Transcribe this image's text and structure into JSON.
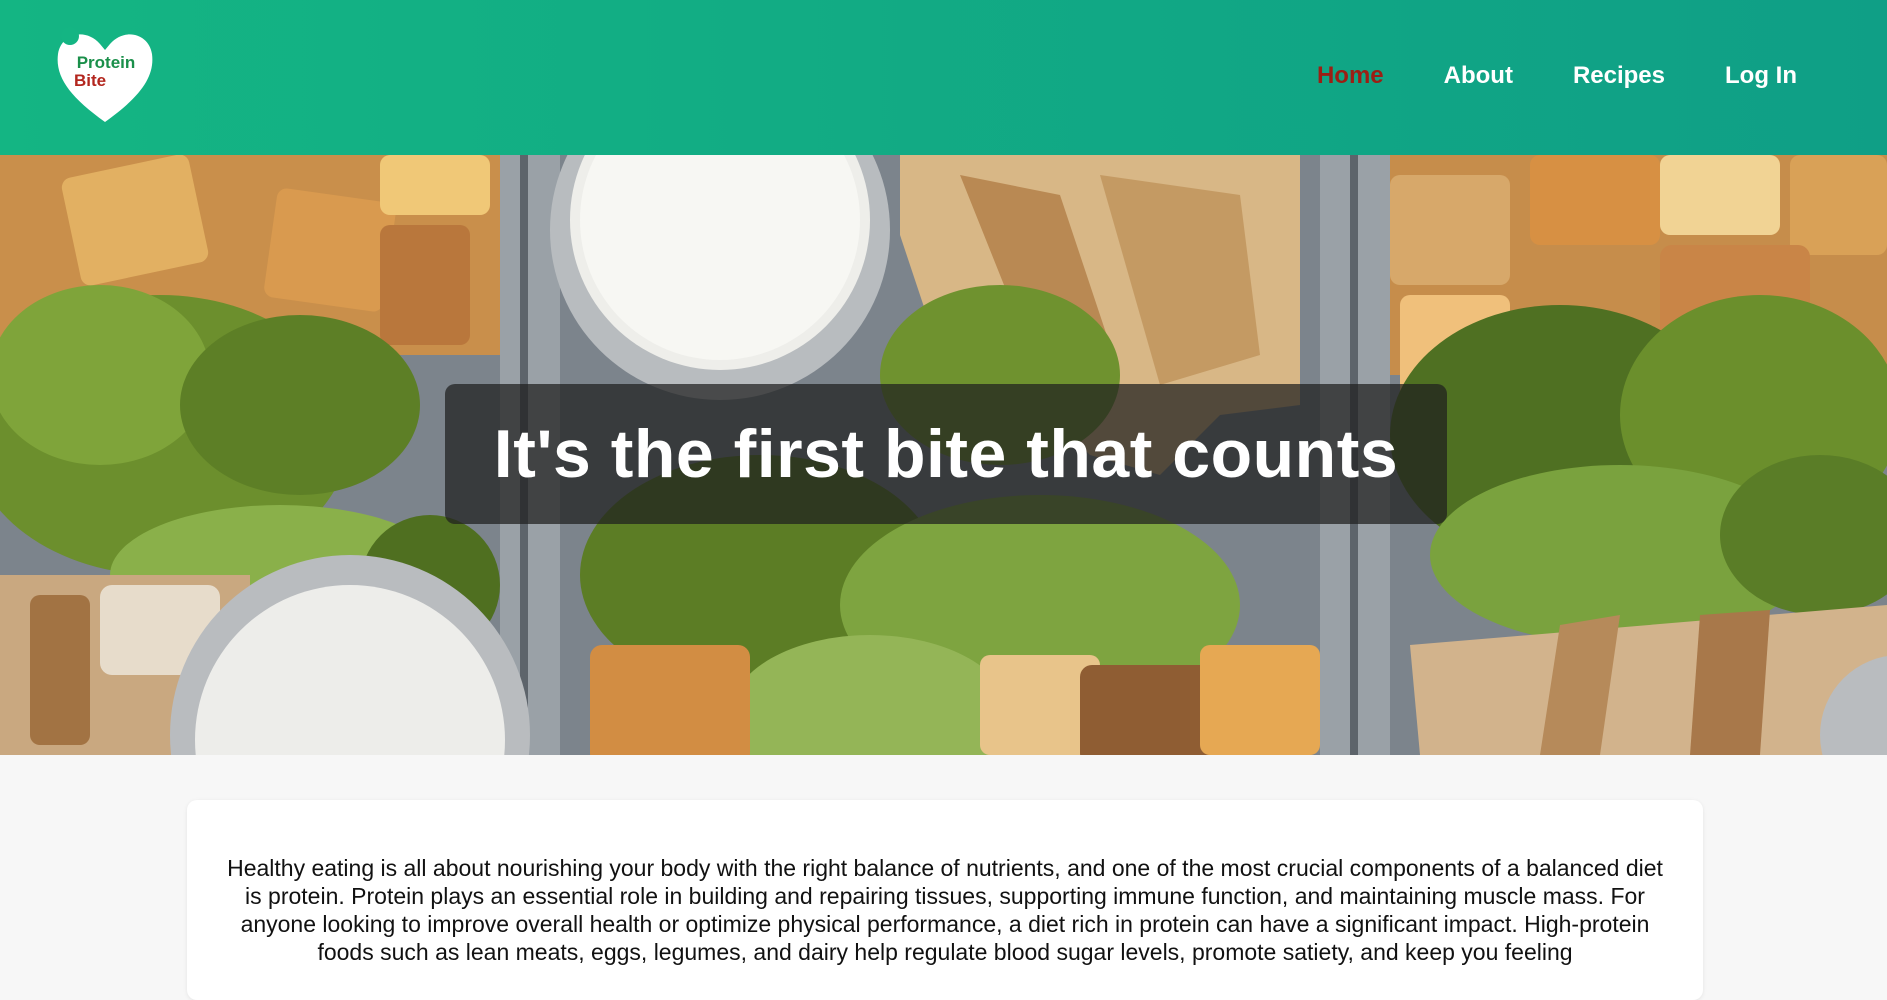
{
  "brand": {
    "logo_line1": "Protein",
    "logo_line2": "Bite",
    "logo_heart_color": "#ffffff",
    "logo_text_green": "#1a8f4a",
    "logo_text_red": "#b3261e"
  },
  "colors": {
    "header_start": "#14b583",
    "header_end": "#0f9f86",
    "nav_active": "#9c1f14",
    "nav_default": "#ffffff"
  },
  "nav": {
    "items": [
      {
        "label": "Home",
        "active": true
      },
      {
        "label": "About",
        "active": false
      },
      {
        "label": "Recipes",
        "active": false
      },
      {
        "label": "Log In",
        "active": false
      }
    ]
  },
  "hero": {
    "title": "It's the first bite that counts"
  },
  "intro": {
    "text": "Healthy eating is all about nourishing your body with the right balance of nutrients, and one of the most crucial components of a balanced diet is protein. Protein plays an essential role in building and repairing tissues, supporting immune function, and maintaining muscle mass. For anyone looking to improve overall health or optimize physical performance, a diet rich in protein can have a significant impact. High-protein foods such as lean meats, eggs, legumes, and dairy help regulate blood sugar levels, promote satiety, and keep you feeling"
  }
}
